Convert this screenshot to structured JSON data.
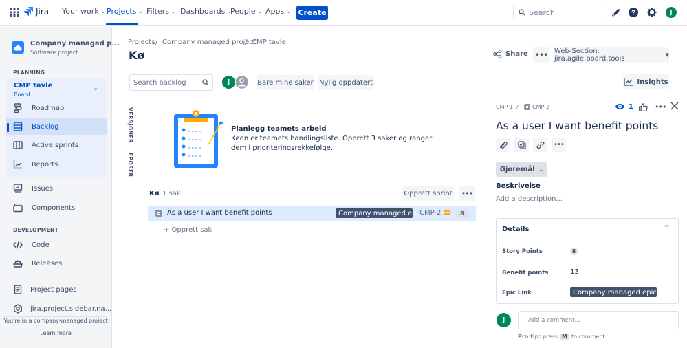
{
  "topnav": {
    "logo": "Jira",
    "items": [
      {
        "label": "Your work",
        "active": false
      },
      {
        "label": "Projects",
        "active": true
      },
      {
        "label": "Filters",
        "active": false
      },
      {
        "label": "Dashboards",
        "active": false
      },
      {
        "label": "People",
        "active": false
      },
      {
        "label": "Apps",
        "active": false
      }
    ],
    "create_label": "Create",
    "search_placeholder": "Search",
    "user_initial": "J"
  },
  "sidebar": {
    "project_name": "Company managed p...",
    "project_type": "Software project",
    "planning_heading": "PLANNING",
    "board_name": "CMP tavle",
    "board_sub": "Board",
    "planning_items": [
      {
        "label": "Roadmap",
        "icon": "roadmap-icon"
      },
      {
        "label": "Backlog",
        "icon": "backlog-icon",
        "selected": true
      },
      {
        "label": "Active sprints",
        "icon": "board-columns-icon"
      },
      {
        "label": "Reports",
        "icon": "reports-icon"
      }
    ],
    "other_items": [
      {
        "label": "Issues",
        "icon": "issues-icon"
      },
      {
        "label": "Components",
        "icon": "components-icon"
      }
    ],
    "development_heading": "DEVELOPMENT",
    "dev_items": [
      {
        "label": "Code",
        "icon": "code-icon"
      },
      {
        "label": "Releases",
        "icon": "releases-icon"
      }
    ],
    "footer_items": [
      {
        "label": "Project pages",
        "icon": "pages-icon"
      },
      {
        "label": "jira.project.sidebar.na...",
        "icon": "settings-icon"
      }
    ],
    "footer_note": "You're in a company-managed project",
    "learn_more": "Learn more"
  },
  "main": {
    "breadcrumb": [
      "Projects",
      "Company managed project",
      "CMP tavle"
    ],
    "title": "Kø",
    "share_label": "Share",
    "web_section_label": "Web-Section: jira.agile.board.tools",
    "insights_label": "Insights",
    "search_placeholder": "Search backlog",
    "filter_avatar_initial": "J",
    "filters": [
      "Bare mine saker",
      "Nylig oppdatert"
    ],
    "side_tabs": [
      "VERSJONER",
      "EPOSER"
    ],
    "empty_state": {
      "title": "Planlegg teamets arbeid",
      "body": "Køen er teamets handlingsliste. Opprett 3 saker og ranger dem i prioriteringsrekkefølge."
    },
    "backlog": {
      "label": "Kø",
      "count": "1 sak",
      "create_sprint_label": "Opprett sprint",
      "issues": [
        {
          "summary": "As a user I want benefit points",
          "epic": "Company managed ep...",
          "key": "CMP-2",
          "priority": "medium",
          "story_points": "8"
        }
      ],
      "create_issue_label": "+ Opprett sak"
    }
  },
  "detail": {
    "parent_key": "CMP-1",
    "issue_key": "CMP-2",
    "watchers": "1",
    "title": "As a user I want benefit points",
    "status": "Gjøremål",
    "description_label": "Beskrivelse",
    "description_placeholder": "Add a description...",
    "details_heading": "Details",
    "fields": [
      {
        "label": "Story Points",
        "value": "8"
      },
      {
        "label": "Benefit points",
        "value": "13"
      },
      {
        "label": "Epic Link",
        "value": "Company managed epic t..."
      }
    ],
    "comment_placeholder": "Add a comment...",
    "pro_tip_label": "Pro tip:",
    "pro_tip_press": "press",
    "pro_tip_key": "M",
    "pro_tip_suffix": "to comment",
    "user_initial": "J"
  },
  "colors": {
    "brand": "#0052cc",
    "avatar": "#00875a",
    "selected_row": "#deebff",
    "priority_medium": "#ffab00"
  }
}
